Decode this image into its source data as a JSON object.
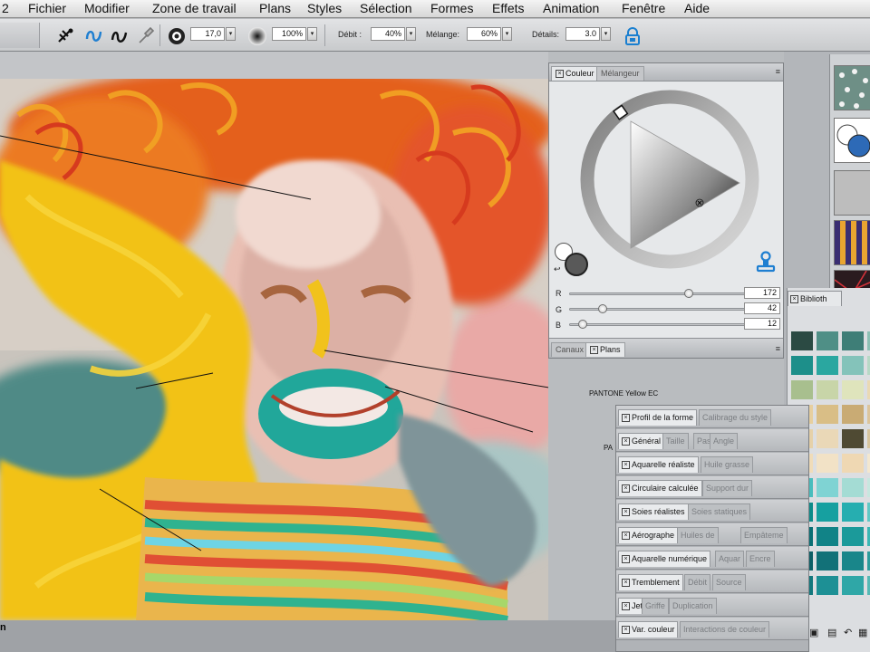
{
  "menubar": {
    "app_fragment": "2",
    "items": [
      "Fichier",
      "Modifier",
      "Zone de travail",
      "Plans",
      "Styles",
      "Sélection",
      "Formes",
      "Effets",
      "Animation",
      "Fenêtre",
      "Aide"
    ]
  },
  "toolbar": {
    "size_value": "17,0",
    "opacity_value": "100%",
    "debit_label": "Débit :",
    "debit_value": "40%",
    "melange_label": "Mélange:",
    "melange_value": "60%",
    "details_label": "Détails:",
    "details_value": "3.0"
  },
  "color_panel": {
    "tab_couleur": "Couleur",
    "tab_melangeur": "Mélangeur",
    "r_label": "R",
    "r_value": "172",
    "r_fraction": 0.675,
    "g_label": "G",
    "g_value": "42",
    "g_fraction": 0.165,
    "b_label": "B",
    "b_value": "12",
    "b_fraction": 0.047,
    "tab_canaux": "Canaux",
    "tab_plans": "Plans",
    "main_color": "#595959",
    "secondary_color": "#ffffff"
  },
  "library": {
    "tab_label": "Biblioth"
  },
  "variants": {
    "rows": [
      {
        "active": "Profil de la forme",
        "inactive": [
          "Calibrage du style"
        ]
      },
      {
        "active": "Général",
        "inactive": [
          "Taille",
          "Pas",
          "Angle"
        ]
      },
      {
        "active": "Aquarelle réaliste",
        "inactive": [
          "Huile grasse"
        ]
      },
      {
        "active": "Circulaire calculée",
        "inactive": [
          "Support dur"
        ]
      },
      {
        "active": "Soies réalistes",
        "inactive": [
          "Soies statiques"
        ]
      },
      {
        "active": "Aérographe",
        "inactive": [
          "Huiles de",
          "Empâteme"
        ]
      },
      {
        "active": "Aquarelle numérique",
        "inactive": [
          "Aquar",
          "Encre"
        ]
      },
      {
        "active": "Tremblement",
        "inactive": [
          "Débit",
          "Source"
        ]
      },
      {
        "active": "Jet",
        "inactive": [
          "Griffe",
          "Duplication"
        ]
      },
      {
        "active": "Var. couleur",
        "inactive": [
          "Interactions de couleur"
        ]
      }
    ]
  },
  "canvas": {
    "annotation_1": "PANTONE Yellow EC",
    "annotation_2": "PA",
    "zoom_fragment": "n"
  }
}
